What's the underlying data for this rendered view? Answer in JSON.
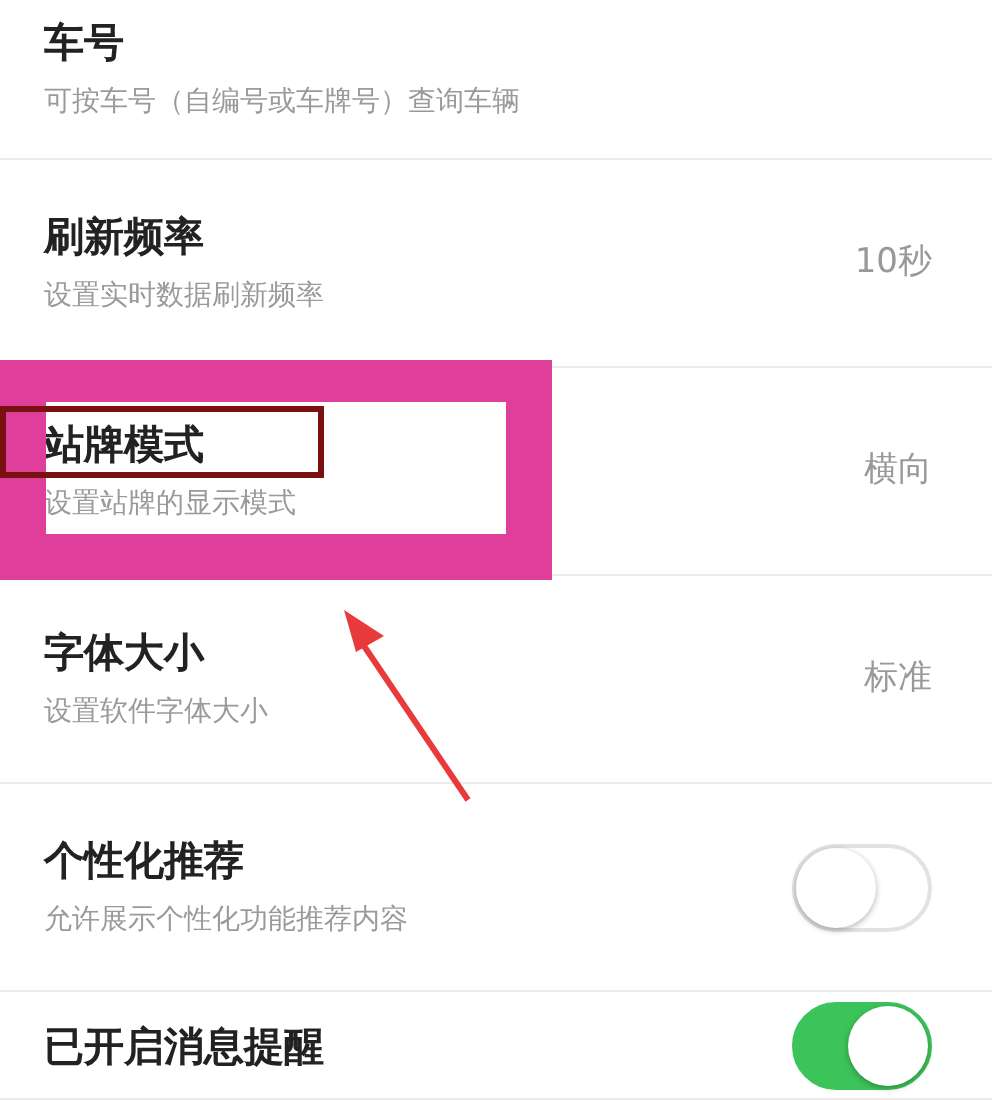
{
  "settings": [
    {
      "kind": "value",
      "title": "车号",
      "subtitle": "可按车号（自编号或车牌号）查询车辆"
    },
    {
      "kind": "value",
      "title": "刷新频率",
      "subtitle": "设置实时数据刷新频率",
      "value": "10秒"
    },
    {
      "kind": "value",
      "title": "站牌模式",
      "subtitle": "设置站牌的显示模式",
      "value": "横向"
    },
    {
      "kind": "value",
      "title": "字体大小",
      "subtitle": "设置软件字体大小",
      "value": "标准"
    },
    {
      "kind": "toggle",
      "title": "个性化推荐",
      "subtitle": "允许展示个性化功能推荐内容",
      "on": false
    },
    {
      "kind": "toggle",
      "title": "已开启消息提醒",
      "on": true
    }
  ],
  "annotations": [
    {
      "kind": "highlight_frame"
    },
    {
      "kind": "outline_box"
    },
    {
      "kind": "arrow"
    }
  ]
}
